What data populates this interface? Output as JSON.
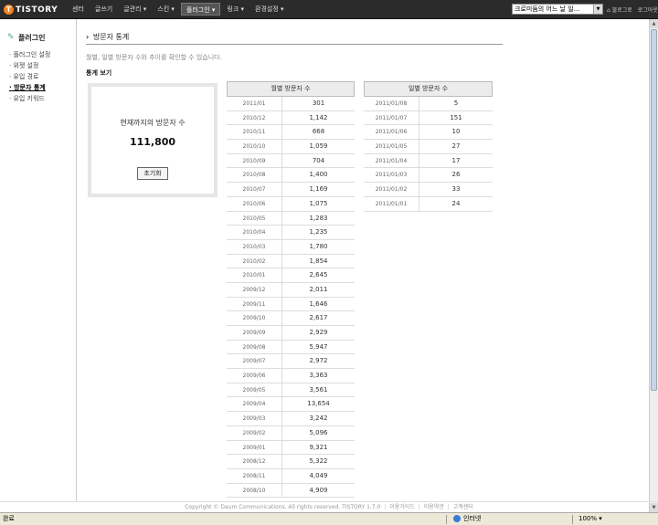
{
  "topbar": {
    "logo_text": "TISTORY",
    "logo_mark": "T",
    "nav": [
      "센터",
      "글쓰기",
      "글관리 ▾",
      "스킨 ▾",
      "플러그인 ▾",
      "링크 ▾",
      "환경설정 ▾"
    ],
    "active_nav_index": 4,
    "blog_select": "크로미듐의 어느 날 일...",
    "links": [
      "⌂ 블로그로",
      "로그아웃"
    ]
  },
  "sidebar": {
    "heading": "플러그인",
    "items": [
      "· 플러그인 설정",
      "· 위젯 설정",
      "· 유입 경로",
      "· 방문자 통계",
      "· 유입 키워드"
    ],
    "selected_index": 3
  },
  "main": {
    "title_arrow": "›",
    "title": "방문자 통계",
    "description": "월별, 일별 방문자 수와 추이를 확인할 수 있습니다.",
    "section_title": "통계 보기",
    "total_label": "현재까지의 방문자 수",
    "total_value": "111,800",
    "reset_label": "초기화"
  },
  "monthly": {
    "header": "월별 방문자 수",
    "rows": [
      [
        "2011/01",
        "301"
      ],
      [
        "2010/12",
        "1,142"
      ],
      [
        "2010/11",
        "668"
      ],
      [
        "2010/10",
        "1,059"
      ],
      [
        "2010/09",
        "704"
      ],
      [
        "2010/08",
        "1,400"
      ],
      [
        "2010/07",
        "1,169"
      ],
      [
        "2010/06",
        "1,075"
      ],
      [
        "2010/05",
        "1,283"
      ],
      [
        "2010/04",
        "1,235"
      ],
      [
        "2010/03",
        "1,780"
      ],
      [
        "2010/02",
        "1,854"
      ],
      [
        "2010/01",
        "2,645"
      ],
      [
        "2009/12",
        "2,011"
      ],
      [
        "2009/11",
        "1,646"
      ],
      [
        "2009/10",
        "2,617"
      ],
      [
        "2009/09",
        "2,929"
      ],
      [
        "2009/08",
        "5,947"
      ],
      [
        "2009/07",
        "2,972"
      ],
      [
        "2009/06",
        "3,363"
      ],
      [
        "2009/05",
        "3,561"
      ],
      [
        "2009/04",
        "13,654"
      ],
      [
        "2009/03",
        "3,242"
      ],
      [
        "2009/02",
        "5,096"
      ],
      [
        "2009/01",
        "9,321"
      ],
      [
        "2008/12",
        "5,322"
      ],
      [
        "2008/11",
        "4,049"
      ],
      [
        "2008/10",
        "4,909"
      ]
    ]
  },
  "daily": {
    "header": "일별 방문자 수",
    "rows": [
      [
        "2011/01/08",
        "5"
      ],
      [
        "2011/01/07",
        "151"
      ],
      [
        "2011/01/06",
        "10"
      ],
      [
        "2011/01/05",
        "27"
      ],
      [
        "2011/01/04",
        "17"
      ],
      [
        "2011/01/03",
        "26"
      ],
      [
        "2011/01/02",
        "33"
      ],
      [
        "2011/01/01",
        "24"
      ]
    ]
  },
  "footer": {
    "copyright": "Copyright © Daum Communications. All rights reserved. TISTORY 1.7.0",
    "links": [
      "이용가이드",
      "이용약관",
      "고객센터"
    ]
  },
  "statusbar": {
    "left": "완료",
    "zone": "인터넷",
    "zoom": "100% ▾"
  },
  "colors": {
    "topbar_bg": "#2b2b2b",
    "logo_orange": "#f58220",
    "table_header_bg": "#ececec",
    "status_bg": "#ece9d8"
  }
}
